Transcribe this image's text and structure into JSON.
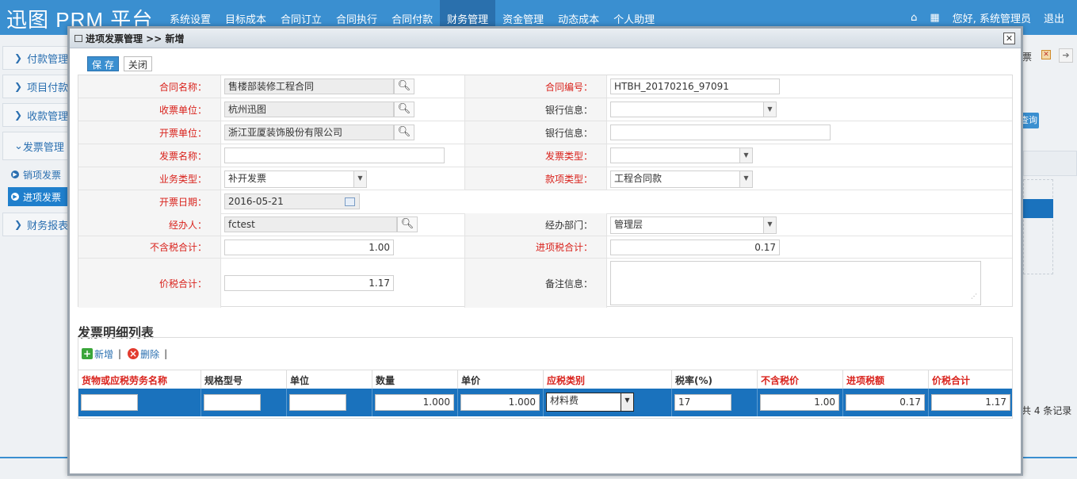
{
  "app": {
    "title": "迅图 PRM 平台"
  },
  "nav": {
    "items": [
      "系统设置",
      "目标成本",
      "合同订立",
      "合同执行",
      "合同付款",
      "财务管理",
      "资金管理",
      "动态成本",
      "个人助理"
    ],
    "active_index": 5,
    "greeting": "您好, 系统管理员",
    "logout": "退出"
  },
  "sidebar": {
    "items": [
      {
        "label": "付款管理"
      },
      {
        "label": "项目付款"
      },
      {
        "label": "收款管理"
      }
    ],
    "open_group": {
      "label": "发票管理",
      "children": [
        {
          "label": "销项发票"
        },
        {
          "label": "进项发票",
          "active": true
        }
      ]
    },
    "after": {
      "label": "财务报表"
    }
  },
  "background": {
    "tab_fragment": "票",
    "query_btn": "查询",
    "records": "共 4 条记录"
  },
  "modal": {
    "title": "进项发票管理 >> 新增",
    "save_label": "保 存",
    "close_label": "关闭",
    "form": {
      "contract_name": {
        "label": "合同名称：",
        "value": "售楼部装修工程合同"
      },
      "contract_no": {
        "label": "合同编号：",
        "value": "HTBH_20170216_97091"
      },
      "payee": {
        "label": "收票单位：",
        "value": "杭州迅图"
      },
      "bank_info1": {
        "label": "银行信息：",
        "value": ""
      },
      "issuer": {
        "label": "开票单位：",
        "value": "浙江亚厦装饰股份有限公司"
      },
      "bank_info2": {
        "label": "银行信息：",
        "value": ""
      },
      "invoice_name": {
        "label": "发票名称：",
        "value": ""
      },
      "invoice_type": {
        "label": "发票类型：",
        "value": ""
      },
      "biz_type": {
        "label": "业务类型：",
        "value": "补开发票"
      },
      "fund_type": {
        "label": "款项类型：",
        "value": "工程合同款"
      },
      "issue_date": {
        "label": "开票日期：",
        "value": "2016-05-21"
      },
      "handler": {
        "label": "经办人：",
        "value": "fctest"
      },
      "dept": {
        "label": "经办部门：",
        "value": "管理层"
      },
      "pretax_total": {
        "label": "不含税合计：",
        "value": "1.00"
      },
      "tax_total": {
        "label": "进项税合计：",
        "value": "0.17"
      },
      "grand_total": {
        "label": "价税合计：",
        "value": "1.17"
      },
      "remark": {
        "label": "备注信息：",
        "value": ""
      }
    },
    "detail": {
      "section_title": "发票明细列表",
      "add_label": "新增",
      "delete_label": "删除",
      "columns": [
        "货物或应税劳务名称",
        "规格型号",
        "单位",
        "数量",
        "单价",
        "应税类别",
        "税率(%)",
        "不含税价",
        "进项税额",
        "价税合计"
      ],
      "row": {
        "name": "",
        "spec": "",
        "unit": "",
        "qty": "1.000",
        "price": "1.000",
        "tax_cat": "材料费",
        "rate": "17",
        "pretax": "1.00",
        "tax": "0.17",
        "total": "1.17"
      }
    }
  }
}
